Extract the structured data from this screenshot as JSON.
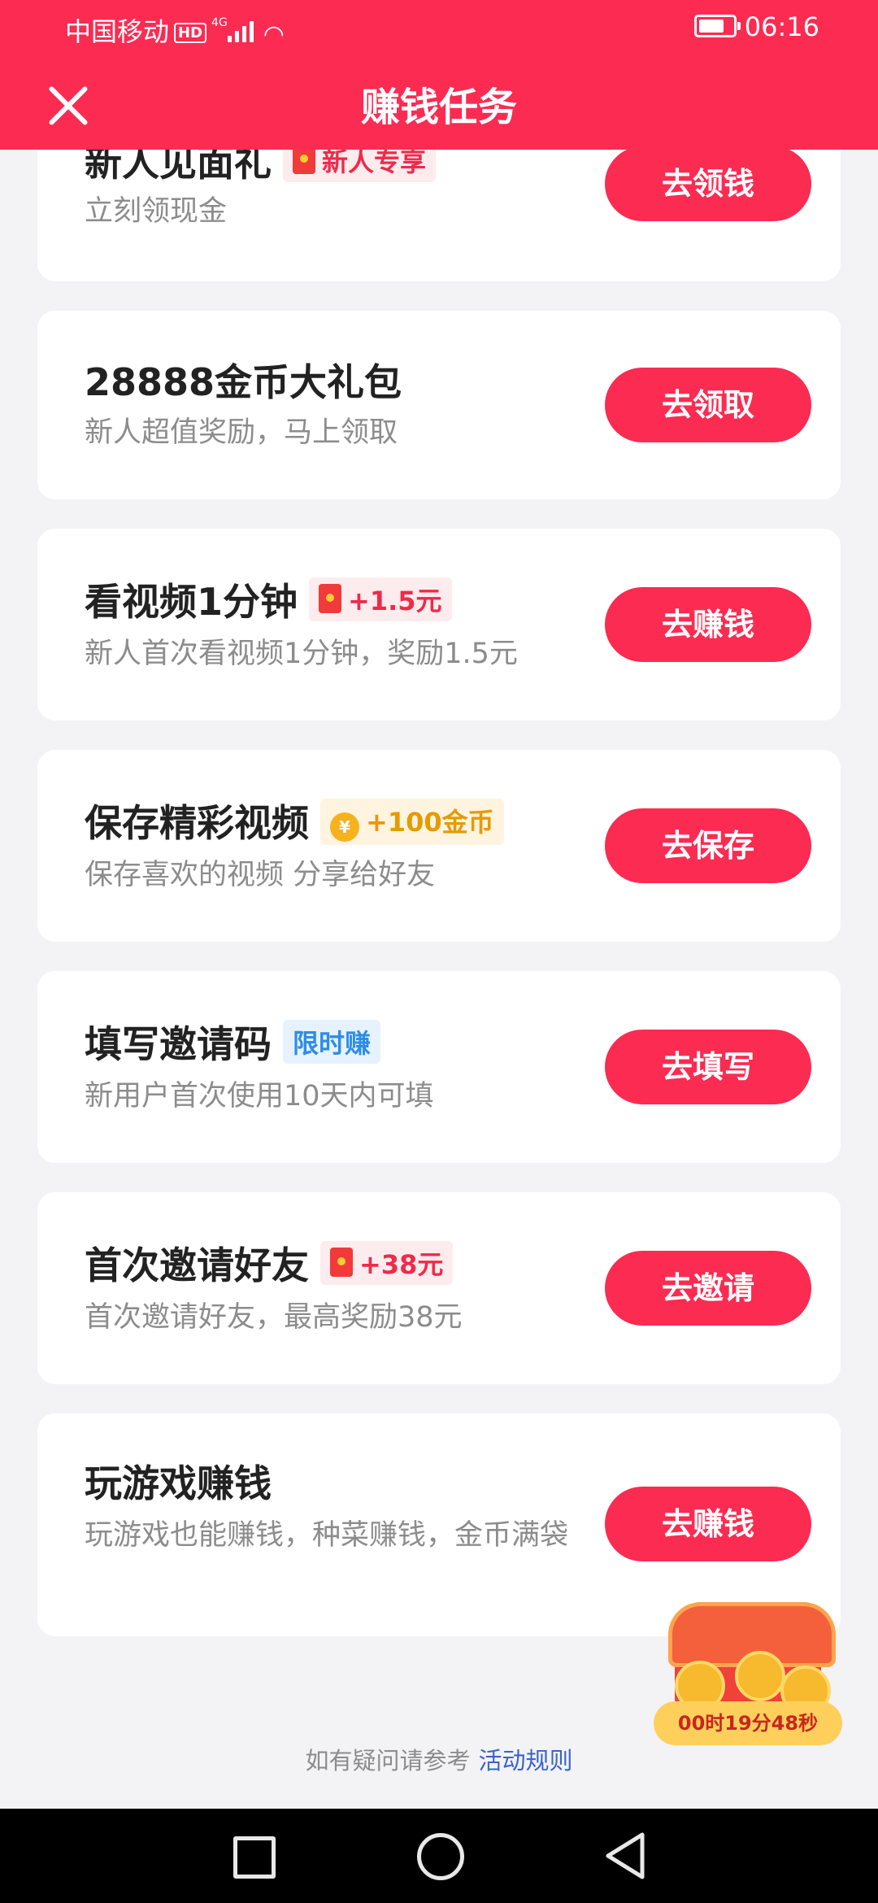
{
  "status_bar": {
    "carrier": "中国移动",
    "hd": "HD",
    "network": "4G",
    "time": "06:16"
  },
  "header": {
    "title": "赚钱任务"
  },
  "tasks": [
    {
      "title": "新人见面礼",
      "badge": "新人专享",
      "badge_style": "red",
      "badge_icon": "red-packet-icon",
      "subtitle": "立刻领现金",
      "action": "去领钱"
    },
    {
      "title": "28888金币大礼包",
      "badge": "",
      "subtitle": "新人超值奖励，马上领取",
      "action": "去领取"
    },
    {
      "title": "看视频1分钟",
      "badge": "+1.5元",
      "badge_style": "red",
      "badge_icon": "red-packet-icon",
      "subtitle": "新人首次看视频1分钟，奖励1.5元",
      "action": "去赚钱"
    },
    {
      "title": "保存精彩视频",
      "badge": "+100金币",
      "badge_style": "gold",
      "badge_icon": "coin-icon",
      "subtitle": "保存喜欢的视频 分享给好友",
      "action": "去保存"
    },
    {
      "title": "填写邀请码",
      "badge": "限时赚",
      "badge_style": "blue",
      "subtitle": "新用户首次使用10天内可填",
      "action": "去填写"
    },
    {
      "title": "首次邀请好友",
      "badge": "+38元",
      "badge_style": "red",
      "badge_icon": "red-packet-icon",
      "subtitle": "首次邀请好友，最高奖励38元",
      "action": "去邀请"
    },
    {
      "title": "玩游戏赚钱",
      "badge": "",
      "subtitle": "玩游戏也能赚钱，种菜赚钱，金币满袋",
      "action": "去赚钱"
    }
  ],
  "treasure": {
    "countdown": "00时19分48秒"
  },
  "footer": {
    "note": "如有疑问请参考",
    "rules_link": "活动规则"
  },
  "colors": {
    "brand": "#fb2b52",
    "background": "#f3f3f5"
  }
}
